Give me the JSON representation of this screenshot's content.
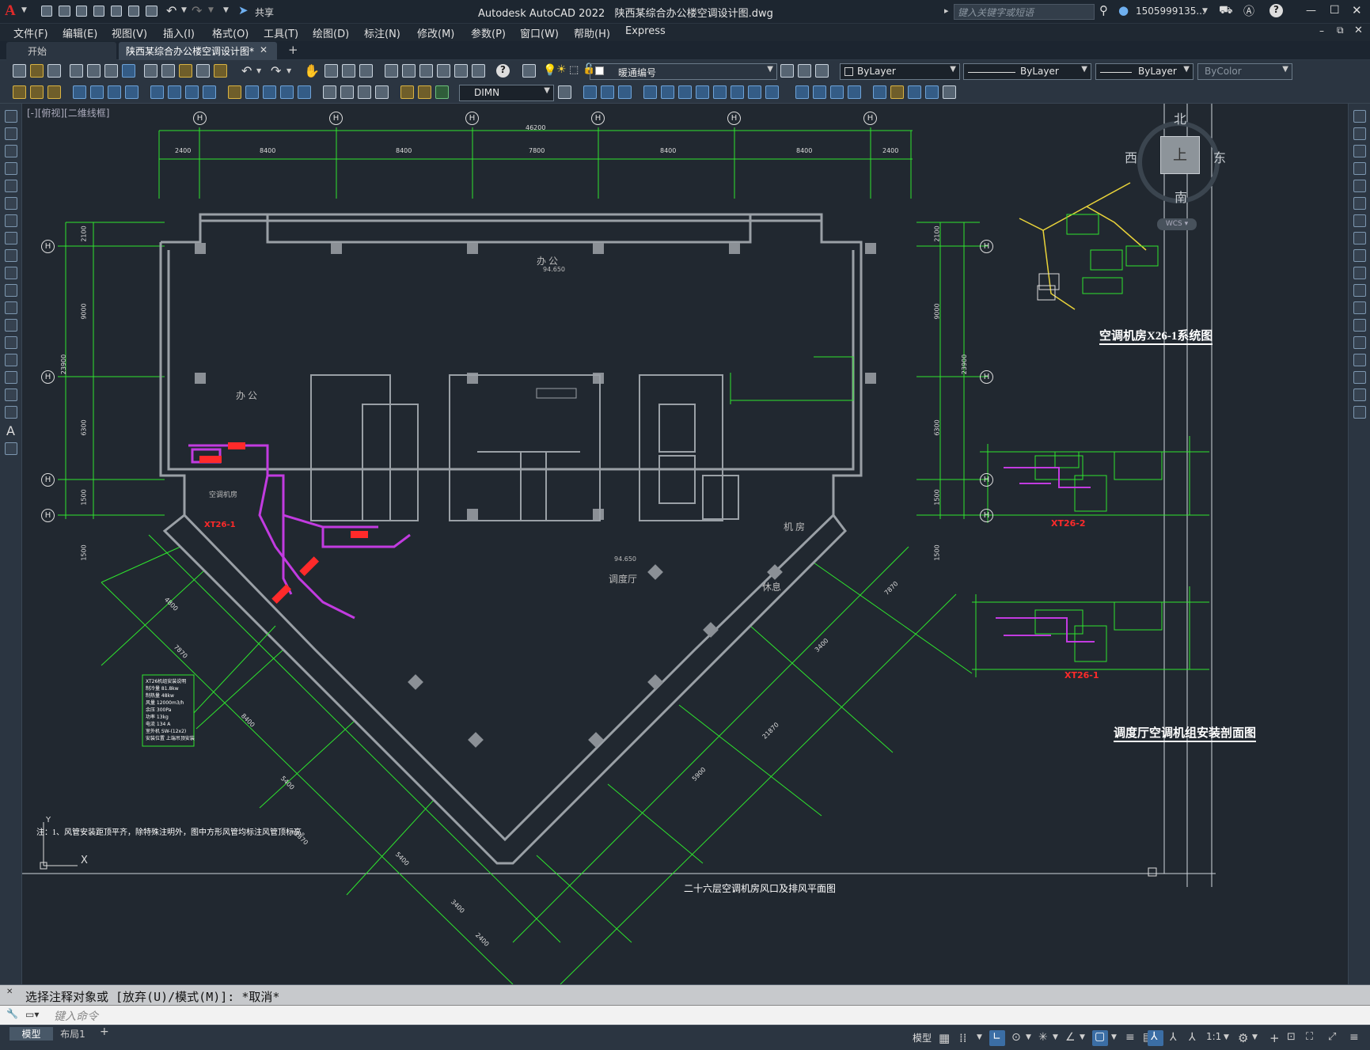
{
  "window": {
    "app_name": "Autodesk AutoCAD 2022",
    "file_name": "陕西某综合办公楼空调设计图.dwg",
    "share_label": "共享",
    "search_placeholder": "键入关键字或短语",
    "user": "1505999135...",
    "help_label": "?"
  },
  "menu": [
    "文件(F)",
    "编辑(E)",
    "视图(V)",
    "插入(I)",
    "格式(O)",
    "工具(T)",
    "绘图(D)",
    "标注(N)",
    "修改(M)",
    "参数(P)",
    "窗口(W)",
    "帮助(H)",
    "Express"
  ],
  "tabs": {
    "start": "开始",
    "active": "陕西某综合办公楼空调设计图*",
    "close": "✕",
    "new": "+"
  },
  "toolbar": {
    "layer_name": "暖通编号",
    "color_value": "ByLayer",
    "linetype_value": "ByLayer",
    "lineweight_value": "ByLayer",
    "plotstyle_value": "ByColor",
    "dimstyle_value": "DIMN"
  },
  "viewport": {
    "label": "[-][俯视][二维线框]",
    "viewcube": {
      "top": "上",
      "north": "北",
      "south": "南",
      "east": "东",
      "west": "西",
      "wcs": "WCS"
    }
  },
  "drawing": {
    "col_labels": [
      "H",
      "H",
      "H",
      "H",
      "H",
      "H"
    ],
    "row_labels": [
      "H",
      "H",
      "H",
      "H"
    ],
    "total_dim": "46200",
    "top_dims": [
      "2400",
      "8400",
      "8400",
      "7800",
      "8400",
      "8400",
      "2400"
    ],
    "left_dims": [
      "2100",
      "9000",
      "6300",
      "1500",
      "1500"
    ],
    "right_dims": [
      "2100",
      "9000",
      "6300",
      "1500",
      "1500"
    ],
    "left_total": "23900",
    "right_total": "23900",
    "room_office_top": "办 公",
    "room_office_left": "办 公",
    "room_dispatch": "调度厅",
    "room_rest": "休息",
    "room_machine": "机 房",
    "room_ac": "空调机房",
    "elev_top": "94.650",
    "elev_center": "94.650",
    "unit_labels": [
      "XT26-1",
      "XT26-2"
    ],
    "system_title": "空调机房X26-1系统图",
    "section_title": "调度厅空调机组安装剖面图",
    "bottom_title": "二十六层空调机房风口及排风平面图",
    "note": "注：1、风管安装距顶平齐，除特殊注明外，图中方形风管均标注风管顶标高。",
    "legend_lines": [
      "XT26机组安装说明",
      "制冷量 81.8kw",
      "制热量 48kw",
      "风量 12000m3/h",
      "余压 300Pa",
      "功率 13kg",
      "电流 134 A",
      "室外机 SW-(12x2)",
      "安装位置 上端吊顶安装"
    ],
    "diag_dims": [
      "4800",
      "7870",
      "5400",
      "21870",
      "8400",
      "5400",
      "3400",
      "2400",
      "5900",
      "3400",
      "21870",
      "7870"
    ],
    "ax_x": "X",
    "ax_y": "Y"
  },
  "command": {
    "history": "选择注释对象或 [放弃(U)/模式(M)]: *取消*",
    "placeholder": "键入命令"
  },
  "status": {
    "model_tab": "模型",
    "layout_tab": "布局1",
    "add": "+",
    "model_btn": "模型",
    "scale": "1:1"
  }
}
